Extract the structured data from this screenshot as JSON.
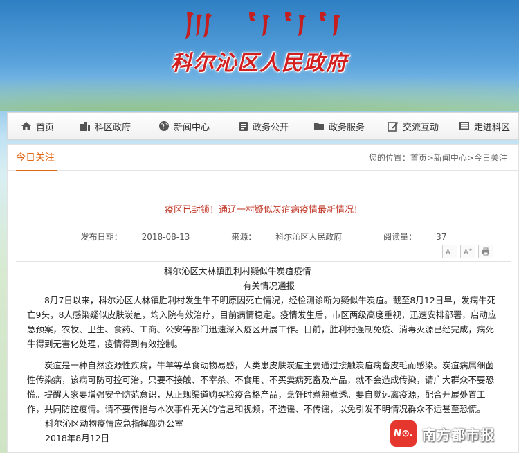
{
  "header": {
    "site_title": "科尔沁区人民政府",
    "mongolian_script": "ᠬᠣᠷᠴᠢᠨ ᠲᠣᠭᠣᠷᠢᠭ ᠤᠨ ᠠᠷᠠᠳ ᠤᠨ ᠵᠠᠰᠠᠭ"
  },
  "nav": {
    "items": [
      {
        "label": "首页",
        "icon": "home-icon"
      },
      {
        "label": "科区政府",
        "icon": "building-icon"
      },
      {
        "label": "新闻中心",
        "icon": "globe-icon"
      },
      {
        "label": "政务公开",
        "icon": "document-icon"
      },
      {
        "label": "政务服务",
        "icon": "folder-icon"
      },
      {
        "label": "交流互动",
        "icon": "edit-icon"
      },
      {
        "label": "走进科区",
        "icon": "book-icon"
      }
    ]
  },
  "section": {
    "tab_label": "今日关注",
    "breadcrumb": {
      "prefix": "您的位置：",
      "home": "首页",
      "sep1": ">",
      "news": "新闻中心",
      "sep2": ">",
      "current": "今日关注"
    }
  },
  "article": {
    "title": "疫区已封锁！通辽一村疑似炭疽病疫情最新情况！",
    "publish_date_label": "发布日期：",
    "publish_date": "2018-08-13",
    "source_label": "来源：",
    "source": "科尔沁区人民政府",
    "reads_label": "阅读量：",
    "reads": "37",
    "tools": {
      "font_smaller": "A-",
      "font_larger": "A+",
      "print": "print"
    },
    "heading1": "科尔沁区大林镇胜利村疑似牛炭疽疫情",
    "heading2": "有关情况通报",
    "para1": "8月7日以来，科尔沁区大林镇胜利村发生牛不明原因死亡情况，经检测诊断为疑似牛炭疽。截至8月12日早，发病牛死亡9头，8人感染疑似皮肤炭疽，均入院有效治疗，目前病情稳定。疫情发生后，市区两级高度重视，迅速安排部署，启动应急预案，农牧、卫生、食药、工商、公安等部门迅速深入疫区开展工作。目前，胜利村强制免疫、消毒灭源已经完成，病死牛得到无害化处理，疫情得到有效控制。",
    "para2": "炭疽是一种自然疫源性疾病，牛羊等草食动物易感，人类患皮肤炭疽主要通过接触炭疽病畜皮毛而感染。炭疽病属细菌性传染病，该病可防可控可治，只要不接触、不宰杀、不食用、不买卖病死畜及产品，就不会造成传染，请广大群众不要恐慌。提醒大家要增强安全防范意识，从正规渠道购买检疫合格产品，烹饪时煮熟煮透。要自觉远离疫源，配合开展处置工作，共同防控疫情。请不要传播与本次事件无关的信息和视频，不造谣、不传谣，以免引发不明情况群众不适甚至恐慌。",
    "signature": "科尔沁区动物疫情应急指挥部办公室",
    "date": "2018年8月12日"
  },
  "watermark": {
    "logo_text": "N⊙.",
    "logo_sub": "南方都市报",
    "text": "南方都市报"
  },
  "colors": {
    "accent": "#e06a1a",
    "title_red": "#d21f1f",
    "article_title": "#c23a2a"
  }
}
